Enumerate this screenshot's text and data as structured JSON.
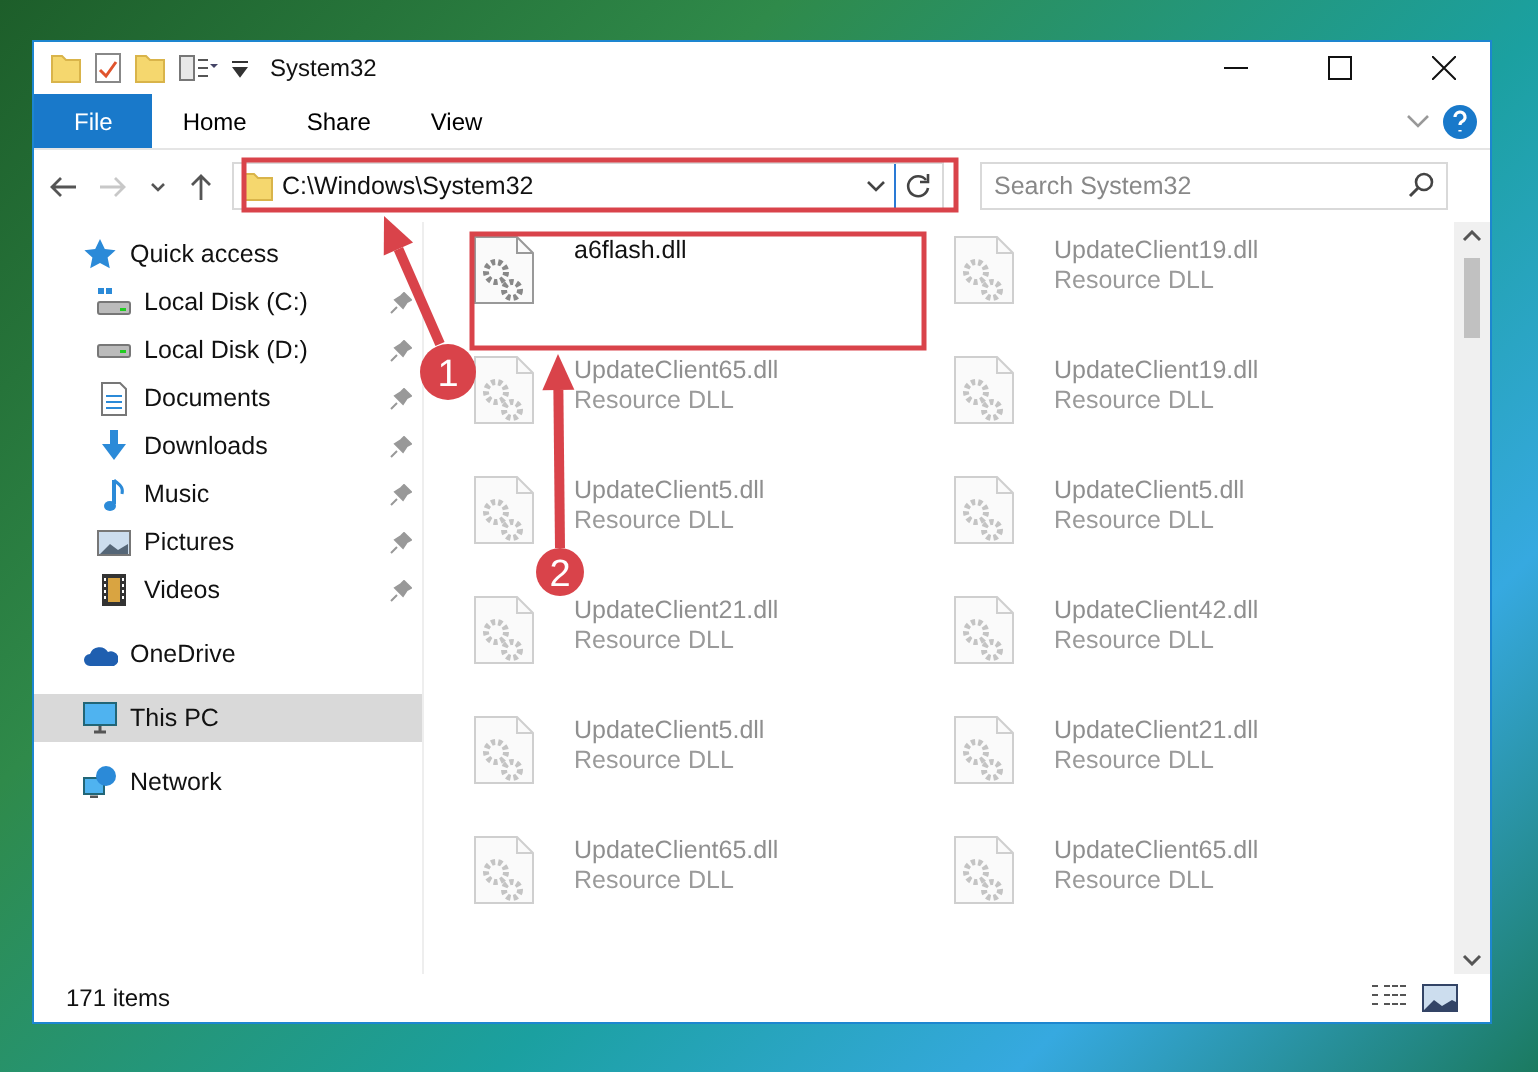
{
  "window": {
    "title": "System32"
  },
  "ribbon_tabs": [
    {
      "label": "File",
      "kind": "file",
      "selected": false
    },
    {
      "label": "Home",
      "kind": "tab",
      "selected": false
    },
    {
      "label": "Share",
      "kind": "tab",
      "selected": false
    },
    {
      "label": "View",
      "kind": "tab",
      "selected": false
    }
  ],
  "address_bar": {
    "path": "C:\\Windows\\System32",
    "forward_disabled": true
  },
  "search": {
    "placeholder": "Search System32"
  },
  "sidebar": {
    "items": [
      {
        "label": "Quick access",
        "kind": "star",
        "selected": false,
        "children": [
          {
            "label": "Local Disk (C:)",
            "kind": "systemdrive",
            "pinned": true,
            "selected": false
          },
          {
            "label": "Local Disk (D:)",
            "kind": "drive",
            "pinned": true,
            "selected": false
          },
          {
            "label": "Documents",
            "kind": "document",
            "pinned": true,
            "selected": false
          },
          {
            "label": "Downloads",
            "kind": "download",
            "pinned": true,
            "selected": false
          },
          {
            "label": "Music",
            "kind": "music",
            "pinned": true,
            "selected": false
          },
          {
            "label": "Pictures",
            "kind": "picture",
            "pinned": true,
            "selected": false
          },
          {
            "label": "Videos",
            "kind": "video",
            "pinned": true,
            "selected": false
          }
        ]
      },
      {
        "label": "OneDrive",
        "kind": "cloud",
        "selected": false
      },
      {
        "label": "This PC",
        "kind": "computer",
        "selected": true
      },
      {
        "label": "Network",
        "kind": "network",
        "selected": false
      }
    ]
  },
  "files": [
    {
      "name": "a6flash.dll",
      "dimmed": false
    },
    {
      "name": "UpdateClient19.dll",
      "type": "Resource DLL",
      "dimmed": true
    },
    {
      "name": "UpdateClient65.dll",
      "type": "Resource DLL",
      "dimmed": true
    },
    {
      "name": "UpdateClient19.dll",
      "type": "Resource DLL",
      "dimmed": true
    },
    {
      "name": "UpdateClient5.dll",
      "type": "Resource DLL",
      "dimmed": true
    },
    {
      "name": "UpdateClient5.dll",
      "type": "Resource DLL",
      "dimmed": true
    },
    {
      "name": "UpdateClient21.dll",
      "type": "Resource DLL",
      "dimmed": true
    },
    {
      "name": "UpdateClient42.dll",
      "type": "Resource DLL",
      "dimmed": true
    },
    {
      "name": "UpdateClient5.dll",
      "type": "Resource DLL",
      "dimmed": true
    },
    {
      "name": "UpdateClient21.dll",
      "type": "Resource DLL",
      "dimmed": true
    },
    {
      "name": "UpdateClient65.dll",
      "type": "Resource DLL",
      "dimmed": true
    },
    {
      "name": "UpdateClient65.dll",
      "type": "Resource DLL",
      "dimmed": true
    }
  ],
  "status_bar": {
    "item_count": "171 items"
  },
  "annotations": [
    {
      "number": "1"
    },
    {
      "number": "2"
    }
  ]
}
